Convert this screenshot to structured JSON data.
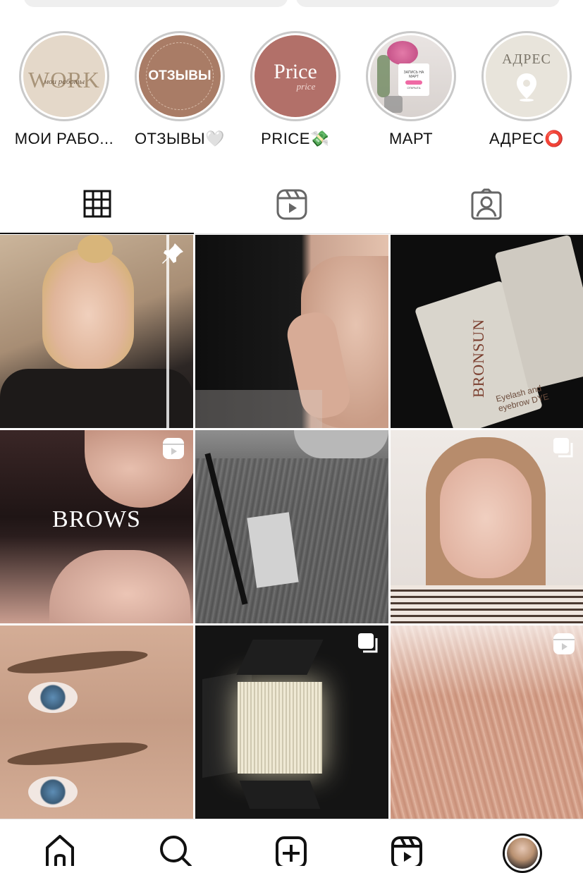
{
  "highlights": [
    {
      "label": "МОИ РАБО...",
      "cover_text": "WORK",
      "cover_sub": "мои работы",
      "icon": "work-cover"
    },
    {
      "label": "ОТЗЫВЫ🤍",
      "cover_text": "ОТЗЫВЫ",
      "icon": "reviews-cover"
    },
    {
      "label": "PRICE💸",
      "cover_text": "Price",
      "cover_sub": "price",
      "icon": "price-cover"
    },
    {
      "label": "МАРТ",
      "cover_text": "ЗАПИСЬ НА МАРТ",
      "cover_sub": "ОТКРЫТА",
      "icon": "flowers-photo"
    },
    {
      "label": "АДРЕС⭕️",
      "cover_text": "АДРЕС",
      "icon": "location-pin"
    }
  ],
  "tabs": [
    {
      "name": "posts",
      "icon": "grid-icon",
      "active": true
    },
    {
      "name": "reels",
      "icon": "reels-icon",
      "active": false
    },
    {
      "name": "tagged",
      "icon": "tagged-icon",
      "active": false
    }
  ],
  "posts": [
    {
      "subject": "blonde model portrait",
      "badge": "pin-icon",
      "colors": [
        "#c9b39a",
        "#3a3431"
      ]
    },
    {
      "subject": "face with hand dark",
      "badge": "",
      "colors": [
        "#1b1b1b",
        "#cfa995"
      ]
    },
    {
      "subject": "Bronsun dye tubes",
      "badge": "",
      "colors": [
        "#111111",
        "#d9d5cc"
      ],
      "text": "BRONSUN",
      "subtext": "Eyelash and eyebrow DYE"
    },
    {
      "subject": "two faces brows",
      "badge": "reels-badge-icon",
      "colors": [
        "#2a1d1d",
        "#c99d8f"
      ],
      "text": "BROWS"
    },
    {
      "subject": "jeans pocket tools",
      "badge": "",
      "colors": [
        "#333333",
        "#9a9a9a"
      ]
    },
    {
      "subject": "girl portrait",
      "badge": "carousel-icon",
      "colors": [
        "#e8e1dc",
        "#b88d7a"
      ]
    },
    {
      "subject": "laminated brows closeup",
      "badge": "",
      "colors": [
        "#c7a28b",
        "#7b5a45"
      ]
    },
    {
      "subject": "LED studio light",
      "badge": "carousel-icon",
      "colors": [
        "#111111",
        "#d9d5c6"
      ]
    },
    {
      "subject": "brow lamination hairs",
      "badge": "reels-badge-icon",
      "colors": [
        "#d6a58e",
        "#f4ece6"
      ]
    }
  ],
  "nav": [
    {
      "name": "home",
      "icon": "home-icon"
    },
    {
      "name": "search",
      "icon": "search-icon"
    },
    {
      "name": "create",
      "icon": "plus-square-icon"
    },
    {
      "name": "reels",
      "icon": "reels-nav-icon"
    },
    {
      "name": "profile",
      "icon": "avatar"
    }
  ]
}
